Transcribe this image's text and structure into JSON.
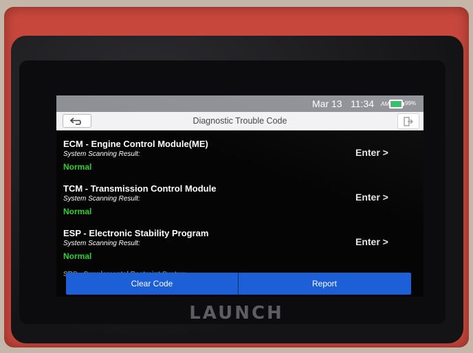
{
  "status_bar": {
    "date": "Mar 13",
    "time": "11:34",
    "ampm": "AM",
    "battery_percent": "99%",
    "battery_level": 0.99,
    "battery_color": "#22c55e"
  },
  "header": {
    "title": "Diagnostic Trouble Code",
    "back_icon": "back-arrow-icon",
    "exit_icon": "exit-icon"
  },
  "modules": [
    {
      "name": "ECM - Engine Control Module(ME)",
      "caption": "System Scanning Result:",
      "status": "Normal",
      "action": "Enter >"
    },
    {
      "name": "TCM - Transmission Control Module",
      "caption": "System Scanning Result:",
      "status": "Normal",
      "action": "Enter >"
    },
    {
      "name": "ESP - Electronic Stability Program",
      "caption": "System Scanning Result:",
      "status": "Normal",
      "action": "Enter >"
    }
  ],
  "partial_module": "SRS - Supplemental Restraint System",
  "footer": {
    "clear_code": "Clear Code",
    "report": "Report"
  },
  "device": {
    "brand": "LAUNCH"
  },
  "colors": {
    "accent": "#1d5fd6",
    "status_ok": "#2dd12d",
    "bezel": "#c8473c"
  }
}
